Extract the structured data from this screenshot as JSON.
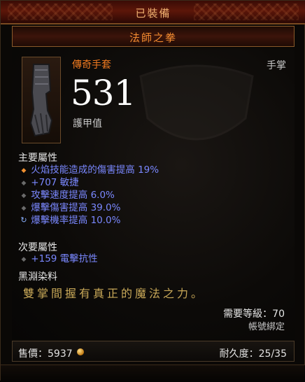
{
  "header": {
    "equipped": "已裝備",
    "item_name": "法師之拳"
  },
  "item": {
    "rarity_type": "傳奇手套",
    "slot": "手掌",
    "armor_value": "531",
    "armor_label": "護甲值"
  },
  "primary": {
    "label": "主要屬性",
    "stats": [
      "火焰技能造成的傷害提高 19%",
      "+707 敏捷",
      "攻擊速度提高 6.0%",
      "爆擊傷害提高 39.0%",
      "爆擊機率提高 10.0%"
    ]
  },
  "secondary": {
    "label": "次要屬性",
    "stats": [
      "+159 電擊抗性"
    ]
  },
  "dye": {
    "label": "黑淵染料"
  },
  "flavor": "雙掌間握有真正的魔法之力。",
  "requirements": {
    "level": "需要等級：70",
    "bound": "帳號綁定"
  },
  "footer": {
    "price": "售價：5937",
    "durability": "耐久度：25/35"
  },
  "colors": {
    "legendary": "#f07a20",
    "magic_stat": "#7a88ff",
    "flavor": "#c8a858"
  }
}
